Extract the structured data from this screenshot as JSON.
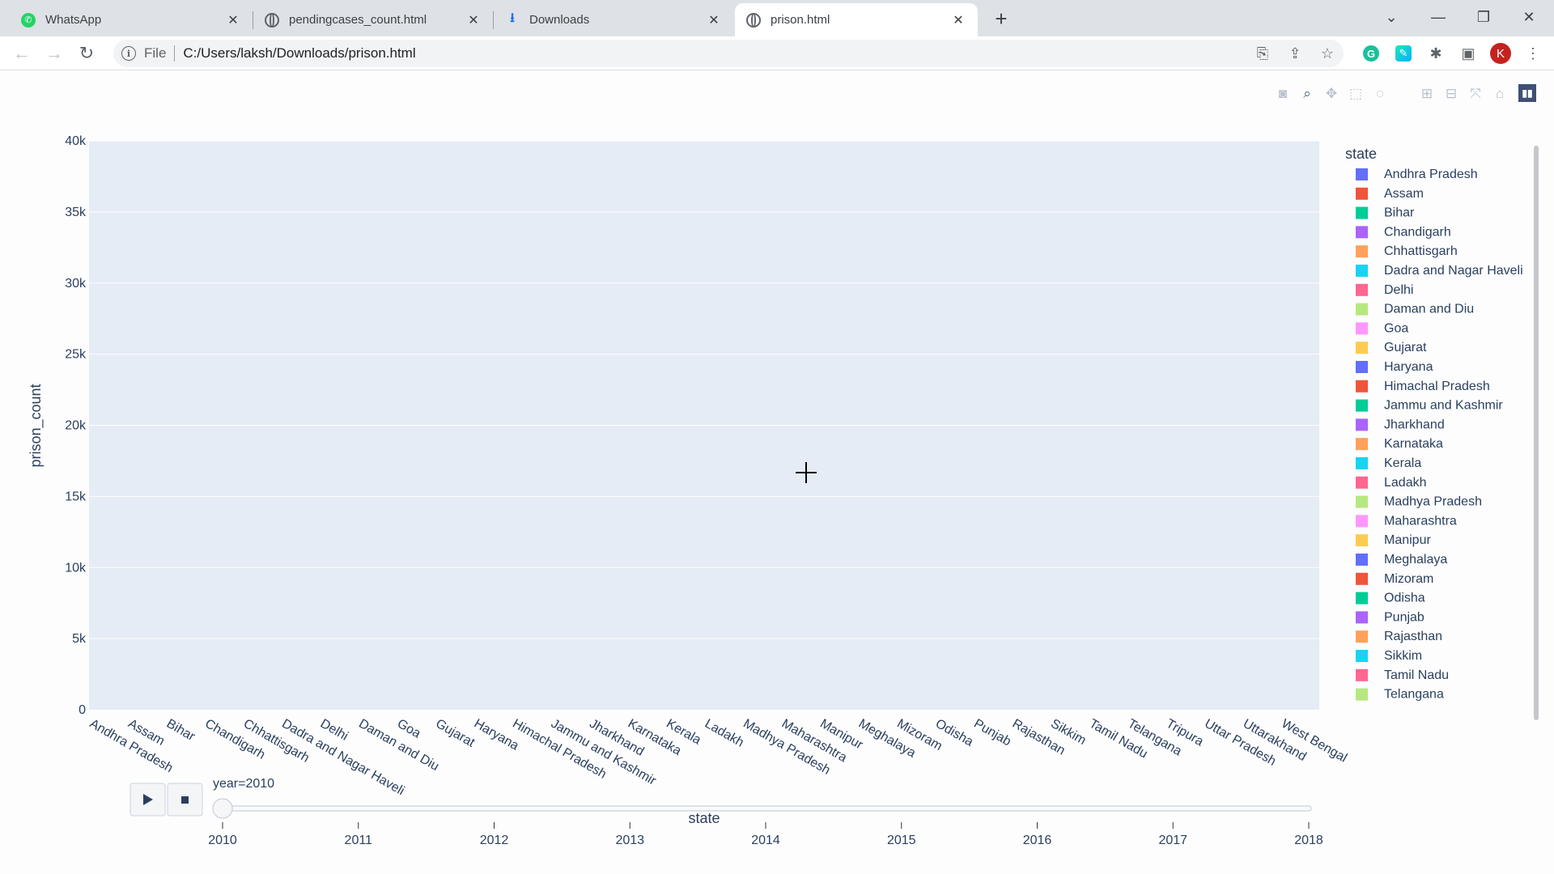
{
  "browser": {
    "tabs": [
      {
        "title": "WhatsApp",
        "icon": "whatsapp-icon",
        "active": false
      },
      {
        "title": "pendingcases_count.html",
        "icon": "globe-icon",
        "active": false
      },
      {
        "title": "Downloads",
        "icon": "download-icon",
        "active": false
      },
      {
        "title": "prison.html",
        "icon": "globe-icon",
        "active": true
      }
    ],
    "url_scheme": "File",
    "url": "C:/Users/laksh/Downloads/prison.html",
    "profile_initial": "K"
  },
  "modebar": {
    "buttons": [
      "camera-icon",
      "zoom-icon",
      "pan-icon",
      "box-select-icon",
      "lasso-select-icon",
      "zoom-in-icon",
      "zoom-out-icon",
      "autoscale-icon",
      "reset-axes-icon"
    ],
    "logo_icon": "plotly-logo-icon"
  },
  "chart_data": {
    "type": "bar",
    "title": "",
    "xlabel": "state",
    "ylabel": "prison_count",
    "ylim": [
      0,
      40000
    ],
    "yticks": [
      "0",
      "5k",
      "10k",
      "15k",
      "20k",
      "25k",
      "30k",
      "35k",
      "40k"
    ],
    "grid": true,
    "categories": [
      "Andhra Pradesh",
      "Assam",
      "Bihar",
      "Chandigarh",
      "Chhattisgarh",
      "Dadra and Nagar Haveli",
      "Delhi",
      "Daman and Diu",
      "Goa",
      "Gujarat",
      "Haryana",
      "Himachal Pradesh",
      "Jammu and Kashmir",
      "Jharkhand",
      "Karnataka",
      "Kerala",
      "Ladakh",
      "Madhya Pradesh",
      "Maharashtra",
      "Manipur",
      "Meghalaya",
      "Mizoram",
      "Odisha",
      "Punjab",
      "Rajasthan",
      "Sikkim",
      "Tamil Nadu",
      "Telangana",
      "Tripura",
      "Uttar Pradesh",
      "Uttarakhand",
      "West Bengal"
    ],
    "values": [],
    "legend": {
      "title": "state",
      "placement": "right",
      "entries": [
        "Andhra Pradesh",
        "Assam",
        "Bihar",
        "Chandigarh",
        "Chhattisgarh",
        "Dadra and Nagar Haveli",
        "Delhi",
        "Daman and Diu",
        "Goa",
        "Gujarat",
        "Haryana",
        "Himachal Pradesh",
        "Jammu and Kashmir",
        "Jharkhand",
        "Karnataka",
        "Kerala",
        "Ladakh",
        "Madhya Pradesh",
        "Maharashtra",
        "Manipur",
        "Meghalaya",
        "Mizoram",
        "Odisha",
        "Punjab",
        "Rajasthan",
        "Sikkim",
        "Tamil Nadu",
        "Telangana"
      ],
      "colors": [
        "#636efa",
        "#EF553B",
        "#00cc96",
        "#ab63fa",
        "#FFA15A",
        "#19d3f3",
        "#FF6692",
        "#B6E880",
        "#FF97FF",
        "#FECB52"
      ]
    },
    "slider": {
      "current_label": "year=2010",
      "current_value": 2010,
      "steps": [
        "2010",
        "2011",
        "2012",
        "2013",
        "2014",
        "2015",
        "2016",
        "2017",
        "2018"
      ]
    },
    "plot_bg": "#e5ecf6"
  }
}
